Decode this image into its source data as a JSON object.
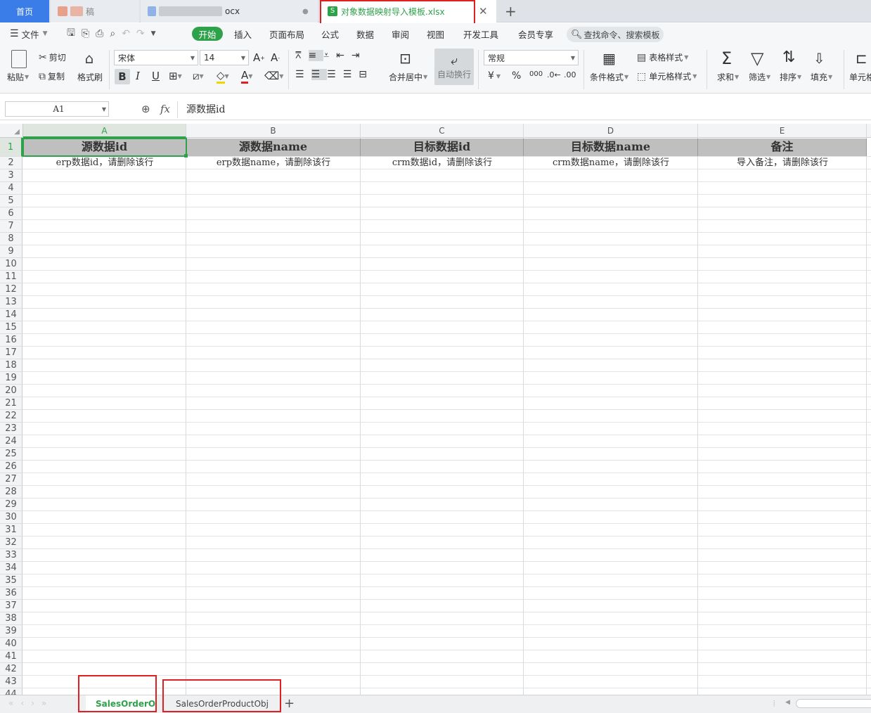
{
  "tabs": {
    "home": "首页",
    "doc1": "稿",
    "doc2": "ocx",
    "active": "对象数据映射导入模板.xlsx",
    "new": "+"
  },
  "menu": {
    "file": "文件",
    "items": [
      "开始",
      "插入",
      "页面布局",
      "公式",
      "数据",
      "审阅",
      "视图",
      "开发工具",
      "会员专享"
    ],
    "search": "查找命令、搜索模板"
  },
  "ribbon": {
    "paste": "粘贴",
    "cut": "剪切",
    "copy": "复制",
    "format_painter": "格式刷",
    "font": "宋体",
    "size": "14",
    "bold": "B",
    "italic": "I",
    "underline": "U",
    "merge": "合并居中",
    "wrap": "自动换行",
    "number_format": "常规",
    "currency": "¥",
    "percent": "%",
    "thousands": "000",
    "cond_format": "条件格式",
    "table_style": "表格样式",
    "cell_style": "单元格样式",
    "sum": "求和",
    "filter": "筛选",
    "sort": "排序",
    "fill": "填充",
    "cell": "单元格"
  },
  "formula": {
    "name_box": "A1",
    "fx": "fx",
    "content": "源数据id"
  },
  "columns": [
    "A",
    "B",
    "C",
    "D",
    "E"
  ],
  "rows": [
    [
      "源数据id",
      "源数据name",
      "目标数据id",
      "目标数据name",
      "备注"
    ],
    [
      "erp数据id，请删除该行",
      "erp数据name，请删除该行",
      "crm数据id，请删除该行",
      "crm数据name，请删除该行",
      "导入备注，请删除该行"
    ]
  ],
  "row_numbers": [
    "1",
    "2",
    "3",
    "4",
    "5",
    "6",
    "7",
    "8",
    "9",
    "10",
    "11",
    "12",
    "13",
    "14",
    "15",
    "16",
    "17",
    "18",
    "19",
    "20",
    "21",
    "22",
    "23",
    "24",
    "25",
    "26",
    "27",
    "28",
    "29",
    "30",
    "31",
    "32",
    "33",
    "34",
    "35",
    "36",
    "37",
    "38",
    "39",
    "40",
    "41",
    "42",
    "43",
    "44"
  ],
  "sheets": [
    "SalesOrderObj",
    "SalesOrderProductObj"
  ],
  "sheet_add": "+",
  "colors": {
    "accent": "#2ea24a",
    "home_tab": "#3a7ce8",
    "highlight": "#e02020",
    "header_fill": "#bfbfbf"
  }
}
